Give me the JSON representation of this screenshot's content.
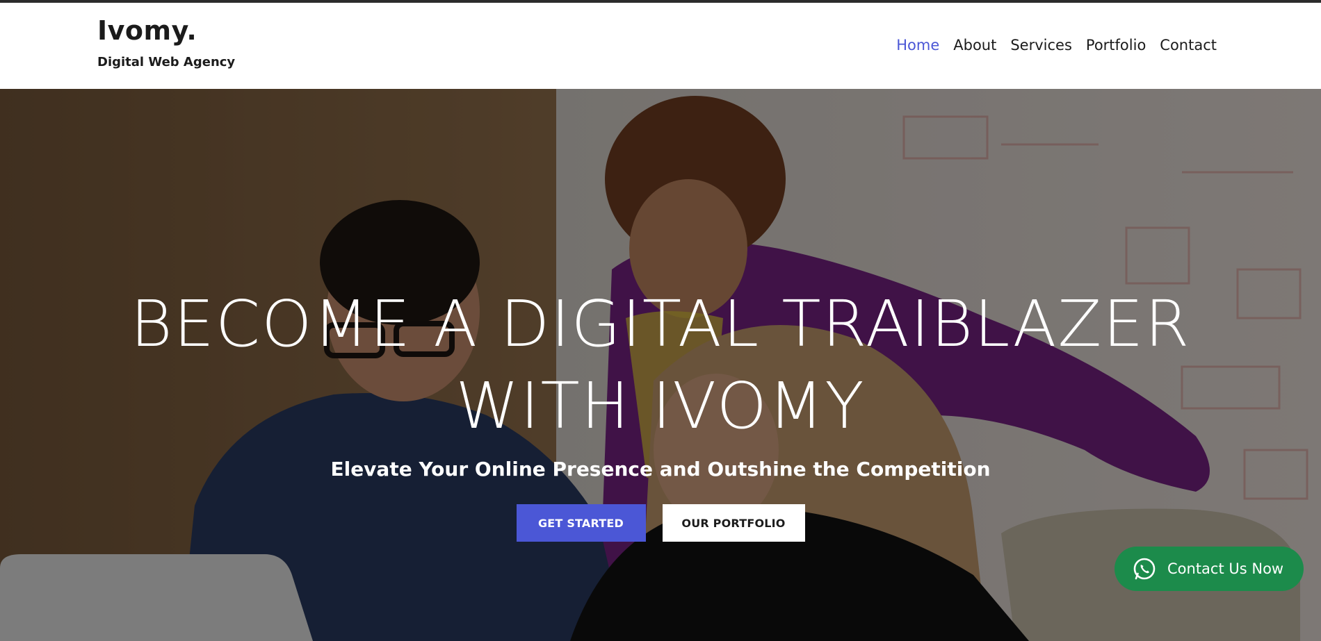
{
  "header": {
    "brand_name": "Ivomy.",
    "brand_tagline": "Digital Web Agency",
    "nav": [
      {
        "label": "Home",
        "active": true
      },
      {
        "label": "About",
        "active": false
      },
      {
        "label": "Services",
        "active": false
      },
      {
        "label": "Portfolio",
        "active": false
      },
      {
        "label": "Contact",
        "active": false
      }
    ]
  },
  "hero": {
    "title_line1": "BECOME A DIGITAL TRAIBLAZER",
    "title_line2": "WITH IVOMY",
    "subtitle": "Elevate Your Online Presence and Outshine the Competition",
    "primary_button": "GET STARTED",
    "secondary_button": "OUR PORTFOLIO",
    "background_image": "team-working-at-laptop-photo"
  },
  "floating": {
    "contact_label": "Contact Us Now",
    "contact_icon": "whatsapp-icon"
  },
  "colors": {
    "accent": "#4b57d6",
    "whatsapp_green": "#1c8b4b",
    "text_dark": "#1b1b1b",
    "hero_text": "#ffffff"
  }
}
